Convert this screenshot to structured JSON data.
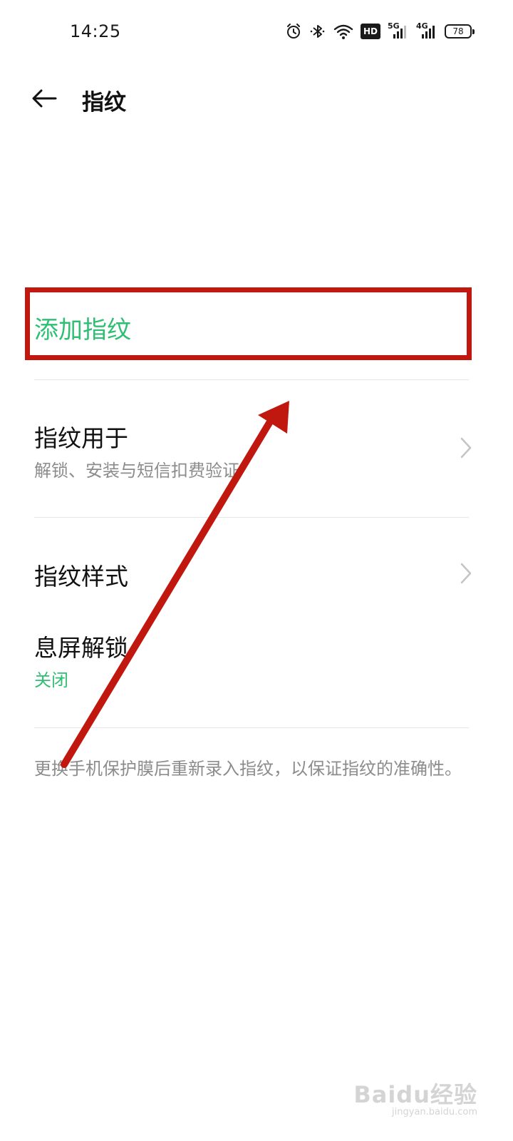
{
  "status_bar": {
    "time": "14:25",
    "icons": [
      "alarm-icon",
      "bluetooth-icon",
      "wifi-icon",
      "hd-icon",
      "signal-5g-icon",
      "signal-4g-icon",
      "battery-icon"
    ],
    "hd_label": "HD",
    "net1_label": "5G",
    "net2_label": "4G",
    "battery": "78"
  },
  "header": {
    "back_icon": "arrow-left-icon",
    "title": "指纹"
  },
  "items": [
    {
      "title": "添加指纹"
    },
    {
      "title": "指纹用于",
      "subtitle": "解锁、安装与短信扣费验证"
    },
    {
      "title": "指纹样式"
    },
    {
      "title": "息屏解锁",
      "subtitle": "关闭"
    }
  ],
  "footnote": "更换手机保护膜后重新录入指纹，以保证指纹的准确性。",
  "watermark": {
    "brand": "Baidu经验",
    "url": "jingyan.baidu.com"
  },
  "colors": {
    "accent_green": "#2fbf73",
    "annotation_red": "#c0180f",
    "text_primary": "#111111",
    "text_secondary": "#8c8c8c"
  }
}
